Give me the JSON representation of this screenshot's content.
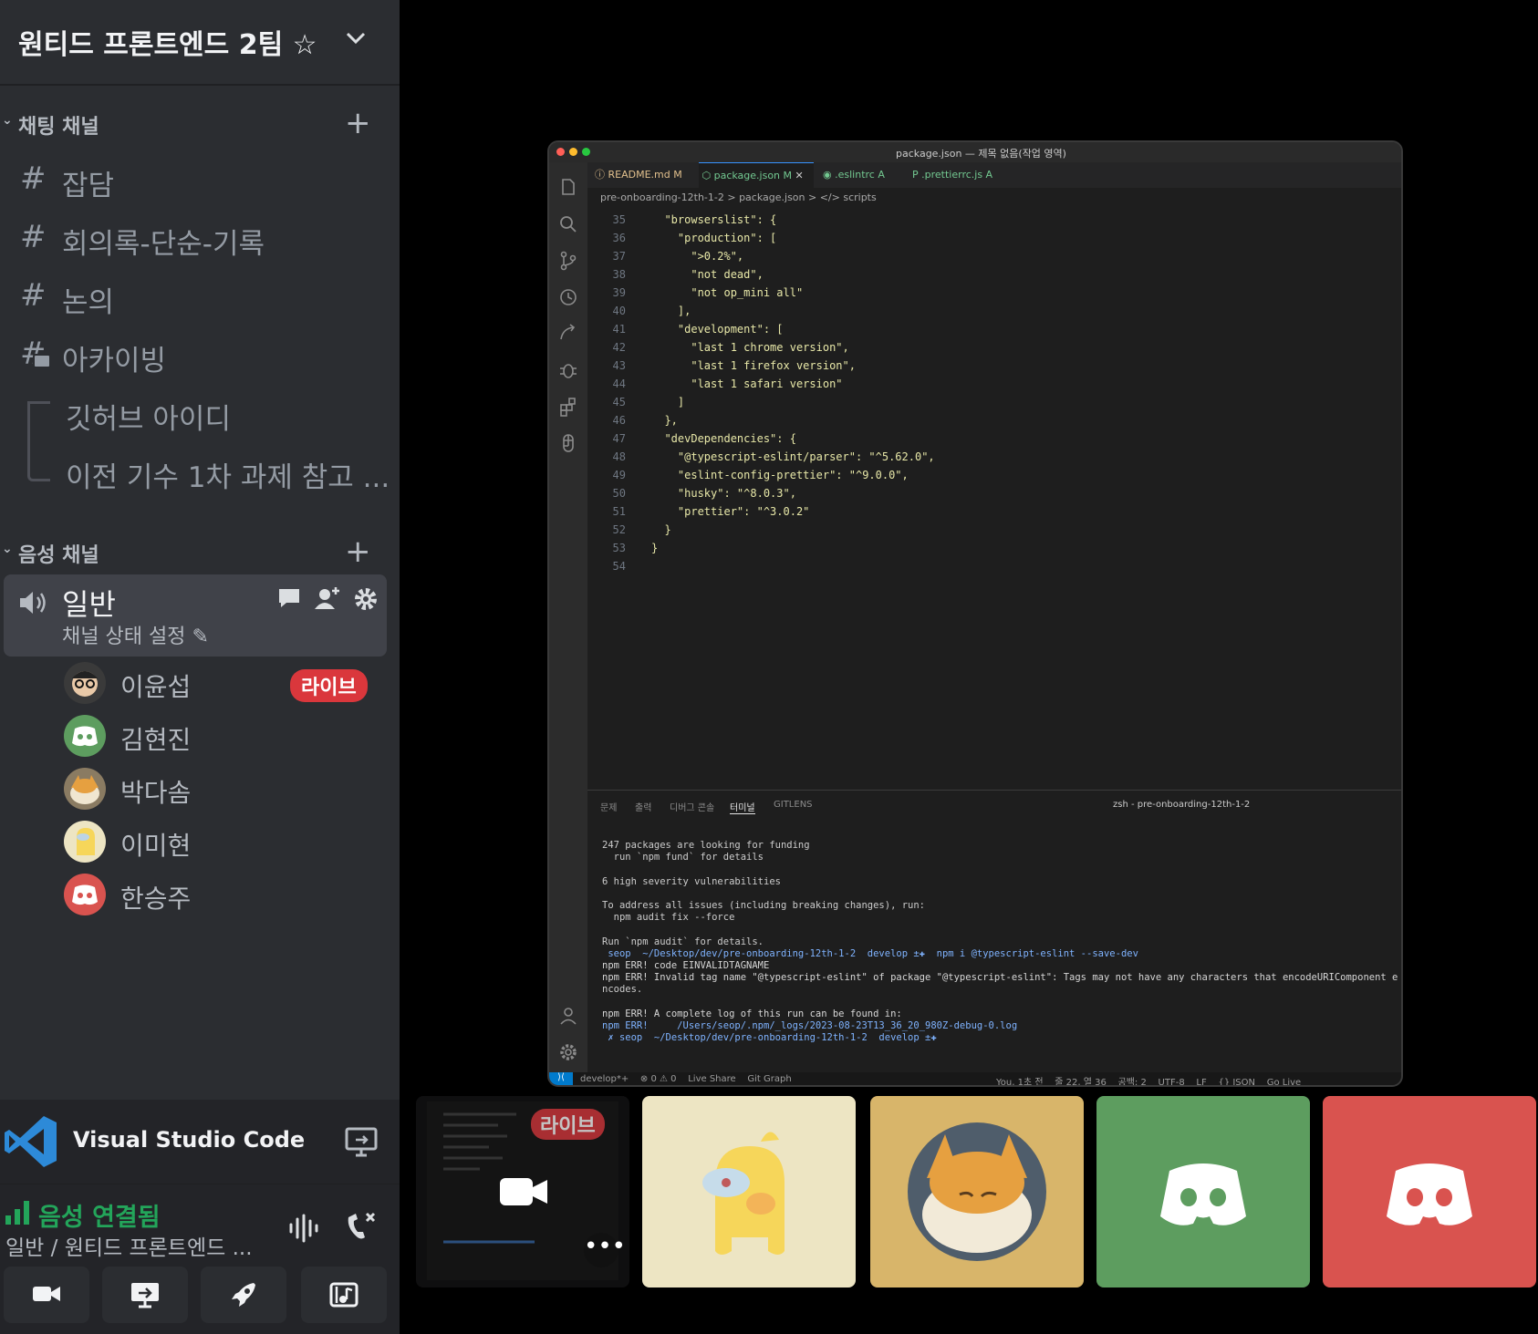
{
  "server": {
    "name": "원티드 프론트엔드 2팀"
  },
  "text_category": {
    "label": "채팅 채널"
  },
  "text_channels": [
    {
      "name": "잡담"
    },
    {
      "name": "회의록-단순-기록"
    },
    {
      "name": "논의"
    },
    {
      "name": "아카이빙"
    }
  ],
  "threads": [
    {
      "name": "깃허브 아이디"
    },
    {
      "name": "이전 기수 1차 과제 참고 ..."
    }
  ],
  "voice_category": {
    "label": "음성 채널"
  },
  "voice_channel": {
    "name": "일반",
    "status": "채널 상태 설정"
  },
  "members": [
    {
      "name": "이윤섭",
      "badge": "라이브"
    },
    {
      "name": "김현진"
    },
    {
      "name": "박다솜"
    },
    {
      "name": "이미현"
    },
    {
      "name": "한승주"
    }
  ],
  "activity": {
    "name": "Visual Studio Code"
  },
  "voice_connection": {
    "status": "음성 연결됨",
    "location": "일반 / 원티드 프론트엔드 ..."
  },
  "colors": {
    "green": "#23a55a",
    "red": "#da373c",
    "discord_green": "#5d9d5f",
    "discord_red": "#d9534f"
  },
  "vscode": {
    "title": "package.json — 제목 없음(작업 영역)",
    "tabs": [
      "README.md M",
      "package.json M",
      ".eslintrc A",
      ".prettierrc.js A"
    ],
    "breadcrumb": "pre-onboarding-12th-1-2 > package.json > </> scripts",
    "code": [
      {
        "n": "35",
        "t": "  \"browserslist\": {"
      },
      {
        "n": "36",
        "t": "    \"production\": ["
      },
      {
        "n": "37",
        "t": "      \">0.2%\","
      },
      {
        "n": "38",
        "t": "      \"not dead\","
      },
      {
        "n": "39",
        "t": "      \"not op_mini all\""
      },
      {
        "n": "40",
        "t": "    ],"
      },
      {
        "n": "41",
        "t": "    \"development\": ["
      },
      {
        "n": "42",
        "t": "      \"last 1 chrome version\","
      },
      {
        "n": "43",
        "t": "      \"last 1 firefox version\","
      },
      {
        "n": "44",
        "t": "      \"last 1 safari version\""
      },
      {
        "n": "45",
        "t": "    ]"
      },
      {
        "n": "46",
        "t": "  },"
      },
      {
        "n": "47",
        "t": "  \"devDependencies\": {"
      },
      {
        "n": "48",
        "t": "    \"@typescript-eslint/parser\": \"^5.62.0\","
      },
      {
        "n": "49",
        "t": "    \"eslint-config-prettier\": \"^9.0.0\","
      },
      {
        "n": "50",
        "t": "    \"husky\": \"^8.0.3\","
      },
      {
        "n": "51",
        "t": "    \"prettier\": \"^3.0.2\""
      },
      {
        "n": "52",
        "t": "  }"
      },
      {
        "n": "53",
        "t": "}"
      },
      {
        "n": "54",
        "t": ""
      }
    ],
    "panel_tabs": [
      "문제",
      "출력",
      "디버그 콘솔",
      "터미널",
      "GITLENS"
    ],
    "terminal_name": "zsh - pre-onboarding-12th-1-2",
    "terminal": [
      "247 packages are looking for funding",
      "  run `npm fund` for details",
      "",
      "6 high severity vulnerabilities",
      "",
      "To address all issues (including breaking changes), run:",
      "  npm audit fix --force",
      "",
      "Run `npm audit` for details.",
      " seop  ~/Desktop/dev/pre-onboarding-12th-1-2  develop ±✚  npm i @typescript-eslint --save-dev",
      "npm ERR! code EINVALIDTAGNAME",
      "npm ERR! Invalid tag name \"@typescript-eslint\" of package \"@typescript-eslint\": Tags may not have any characters that encodeURIComponent e",
      "ncodes.",
      "",
      "npm ERR! A complete log of this run can be found in:",
      "npm ERR!     /Users/seop/.npm/_logs/2023-08-23T13_36_20_980Z-debug-0.log",
      " ✗ seop  ~/Desktop/dev/pre-onboarding-12th-1-2  develop ±✚ "
    ],
    "status_left": "develop*+    ⊗ 0 ⚠ 0    Live Share    Git Graph",
    "status_right": "You, 1초 전    줄 22, 열 36    공백: 2    UTF-8    LF    {} JSON    Go Live"
  },
  "tiles": [
    {
      "type": "stream",
      "badge": "라이브"
    },
    {
      "type": "avatar",
      "bg": "#ede5c3"
    },
    {
      "type": "avatar",
      "bg": "#d8b56a"
    },
    {
      "type": "discord",
      "bg": "#5d9d5f"
    },
    {
      "type": "discord",
      "bg": "#d9534f"
    }
  ]
}
